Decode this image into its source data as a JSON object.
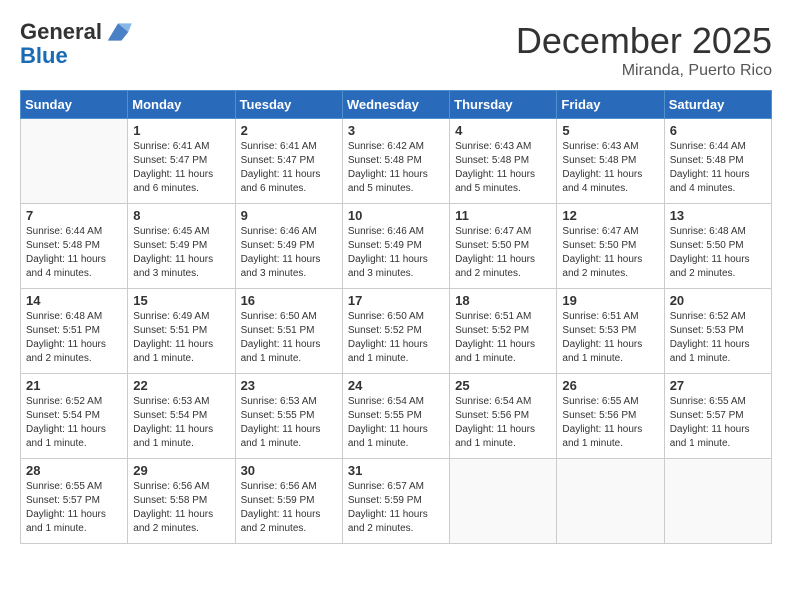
{
  "header": {
    "logo_line1": "General",
    "logo_line2": "Blue",
    "month_title": "December 2025",
    "location": "Miranda, Puerto Rico"
  },
  "weekdays": [
    "Sunday",
    "Monday",
    "Tuesday",
    "Wednesday",
    "Thursday",
    "Friday",
    "Saturday"
  ],
  "weeks": [
    [
      {
        "day": "",
        "info": ""
      },
      {
        "day": "1",
        "info": "Sunrise: 6:41 AM\nSunset: 5:47 PM\nDaylight: 11 hours\nand 6 minutes."
      },
      {
        "day": "2",
        "info": "Sunrise: 6:41 AM\nSunset: 5:47 PM\nDaylight: 11 hours\nand 6 minutes."
      },
      {
        "day": "3",
        "info": "Sunrise: 6:42 AM\nSunset: 5:48 PM\nDaylight: 11 hours\nand 5 minutes."
      },
      {
        "day": "4",
        "info": "Sunrise: 6:43 AM\nSunset: 5:48 PM\nDaylight: 11 hours\nand 5 minutes."
      },
      {
        "day": "5",
        "info": "Sunrise: 6:43 AM\nSunset: 5:48 PM\nDaylight: 11 hours\nand 4 minutes."
      },
      {
        "day": "6",
        "info": "Sunrise: 6:44 AM\nSunset: 5:48 PM\nDaylight: 11 hours\nand 4 minutes."
      }
    ],
    [
      {
        "day": "7",
        "info": "Sunrise: 6:44 AM\nSunset: 5:48 PM\nDaylight: 11 hours\nand 4 minutes."
      },
      {
        "day": "8",
        "info": "Sunrise: 6:45 AM\nSunset: 5:49 PM\nDaylight: 11 hours\nand 3 minutes."
      },
      {
        "day": "9",
        "info": "Sunrise: 6:46 AM\nSunset: 5:49 PM\nDaylight: 11 hours\nand 3 minutes."
      },
      {
        "day": "10",
        "info": "Sunrise: 6:46 AM\nSunset: 5:49 PM\nDaylight: 11 hours\nand 3 minutes."
      },
      {
        "day": "11",
        "info": "Sunrise: 6:47 AM\nSunset: 5:50 PM\nDaylight: 11 hours\nand 2 minutes."
      },
      {
        "day": "12",
        "info": "Sunrise: 6:47 AM\nSunset: 5:50 PM\nDaylight: 11 hours\nand 2 minutes."
      },
      {
        "day": "13",
        "info": "Sunrise: 6:48 AM\nSunset: 5:50 PM\nDaylight: 11 hours\nand 2 minutes."
      }
    ],
    [
      {
        "day": "14",
        "info": "Sunrise: 6:48 AM\nSunset: 5:51 PM\nDaylight: 11 hours\nand 2 minutes."
      },
      {
        "day": "15",
        "info": "Sunrise: 6:49 AM\nSunset: 5:51 PM\nDaylight: 11 hours\nand 1 minute."
      },
      {
        "day": "16",
        "info": "Sunrise: 6:50 AM\nSunset: 5:51 PM\nDaylight: 11 hours\nand 1 minute."
      },
      {
        "day": "17",
        "info": "Sunrise: 6:50 AM\nSunset: 5:52 PM\nDaylight: 11 hours\nand 1 minute."
      },
      {
        "day": "18",
        "info": "Sunrise: 6:51 AM\nSunset: 5:52 PM\nDaylight: 11 hours\nand 1 minute."
      },
      {
        "day": "19",
        "info": "Sunrise: 6:51 AM\nSunset: 5:53 PM\nDaylight: 11 hours\nand 1 minute."
      },
      {
        "day": "20",
        "info": "Sunrise: 6:52 AM\nSunset: 5:53 PM\nDaylight: 11 hours\nand 1 minute."
      }
    ],
    [
      {
        "day": "21",
        "info": "Sunrise: 6:52 AM\nSunset: 5:54 PM\nDaylight: 11 hours\nand 1 minute."
      },
      {
        "day": "22",
        "info": "Sunrise: 6:53 AM\nSunset: 5:54 PM\nDaylight: 11 hours\nand 1 minute."
      },
      {
        "day": "23",
        "info": "Sunrise: 6:53 AM\nSunset: 5:55 PM\nDaylight: 11 hours\nand 1 minute."
      },
      {
        "day": "24",
        "info": "Sunrise: 6:54 AM\nSunset: 5:55 PM\nDaylight: 11 hours\nand 1 minute."
      },
      {
        "day": "25",
        "info": "Sunrise: 6:54 AM\nSunset: 5:56 PM\nDaylight: 11 hours\nand 1 minute."
      },
      {
        "day": "26",
        "info": "Sunrise: 6:55 AM\nSunset: 5:56 PM\nDaylight: 11 hours\nand 1 minute."
      },
      {
        "day": "27",
        "info": "Sunrise: 6:55 AM\nSunset: 5:57 PM\nDaylight: 11 hours\nand 1 minute."
      }
    ],
    [
      {
        "day": "28",
        "info": "Sunrise: 6:55 AM\nSunset: 5:57 PM\nDaylight: 11 hours\nand 1 minute."
      },
      {
        "day": "29",
        "info": "Sunrise: 6:56 AM\nSunset: 5:58 PM\nDaylight: 11 hours\nand 2 minutes."
      },
      {
        "day": "30",
        "info": "Sunrise: 6:56 AM\nSunset: 5:59 PM\nDaylight: 11 hours\nand 2 minutes."
      },
      {
        "day": "31",
        "info": "Sunrise: 6:57 AM\nSunset: 5:59 PM\nDaylight: 11 hours\nand 2 minutes."
      },
      {
        "day": "",
        "info": ""
      },
      {
        "day": "",
        "info": ""
      },
      {
        "day": "",
        "info": ""
      }
    ]
  ]
}
